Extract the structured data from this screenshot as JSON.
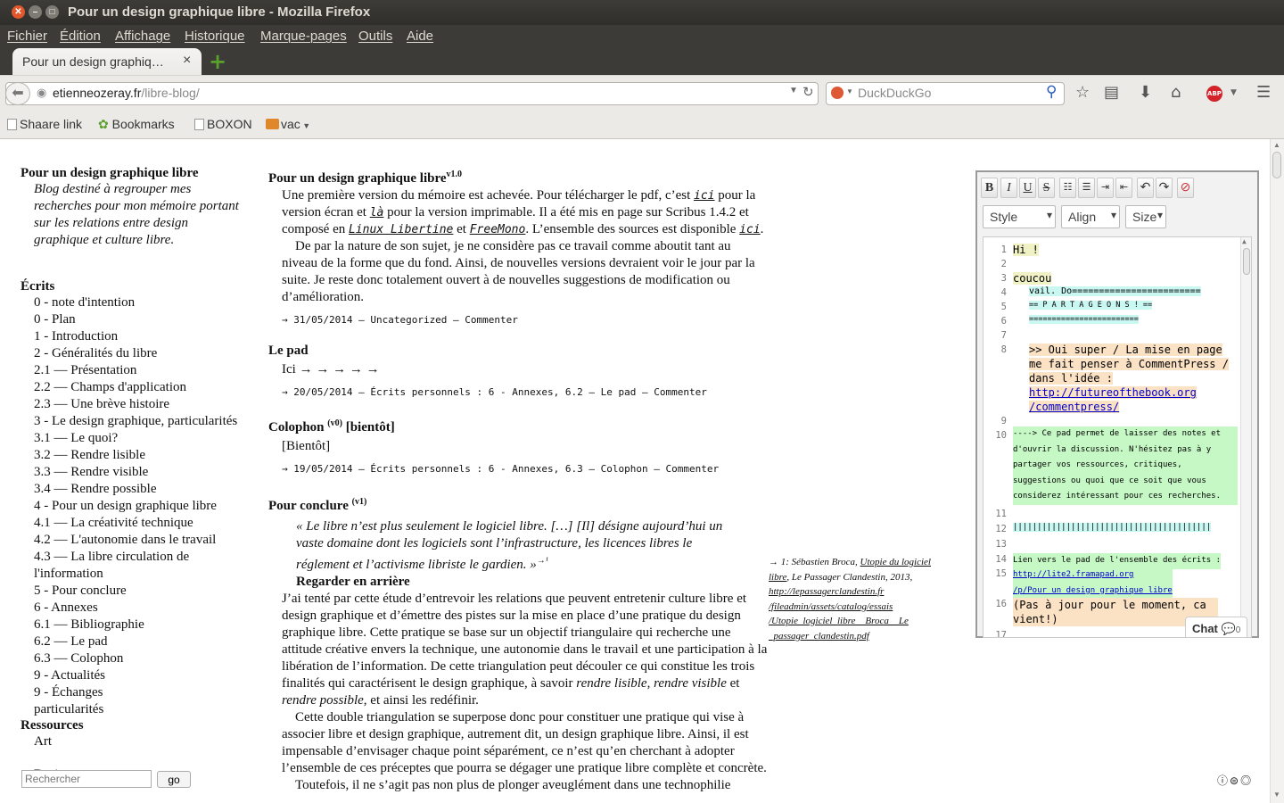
{
  "window": {
    "title": "Pour un design graphique libre - Mozilla Firefox"
  },
  "menu": [
    "Fichier",
    "Édition",
    "Affichage",
    "Historique",
    "Marque-pages",
    "Outils",
    "Aide"
  ],
  "tab": {
    "label": "Pour un design graphiq…",
    "close": "×",
    "new_tab": "+"
  },
  "urlbar": {
    "domain": "etienneozeray.fr",
    "path": "/libre-blog/"
  },
  "search": {
    "placeholder": "DuckDuckGo"
  },
  "bookmarks": [
    "Shaare link",
    "Bookmarks",
    "BOXON",
    "vac"
  ],
  "sidebar": {
    "site_title": "Pour un design graphique libre",
    "site_desc": "Blog destiné à regrouper mes recherches pour mon mémoire portant sur les relations entre design graphique et culture libre.",
    "ecrits_heading": "Écrits",
    "ecrits": [
      "0 - note d'intention",
      "0 - Plan",
      "1 - Introduction",
      "2 - Généralités du libre",
      "2.1 — Présentation",
      "2.2 — Champs d'application",
      "2.3 — Une brève histoire",
      "3 - Le design graphique, particularités",
      "3.1 — Le quoi?",
      "3.2 — Rendre lisible",
      "3.3 — Rendre visible",
      "3.4 — Rendre possible",
      "4 - Pour un design graphique libre",
      "4.1 — La créativité technique",
      "4.2 — L'autonomie dans le travail",
      "4.3 — La libre circulation de l'information",
      "5 - Pour conclure",
      "6 - Annexes",
      "6.1 — Bibliographie",
      "6.2 — Le pad",
      "6.3 — Colophon",
      "9 - Actualités",
      "9 - Échanges particularités"
    ],
    "ressources_heading": "Ressources",
    "ressources": [
      "Art",
      "Designers"
    ],
    "search_placeholder": "Rechercher",
    "search_button": "go"
  },
  "posts": {
    "p1": {
      "title": "Pour un design graphique libre",
      "version": "v1.0",
      "t1": "Une première version du mémoire est achevée. Pour télécharger le pdf, c’est ",
      "ici": "ici",
      "t2": " pour la version écran et ",
      "la": "là",
      "t3": " pour la version imprimable. Il a été mis en page sur Scribus 1.4.2 et composé en ",
      "font1": "Linux Libertine",
      "t4": " et ",
      "font2": "FreeMono",
      "t5": ". L’ensemble des sources est disponible ",
      "t6": ".",
      "para2": "De par la nature de son sujet, je ne considère pas ce travail comme aboutit tant au niveau de la forme que du fond. Ainsi, de nouvelles versions devraient voir le jour par la suite. Je reste donc totalement ouvert à de nouvelles suggestions de modification ou d’amélioration.",
      "meta": "→ 31/05/2014 — Uncategorized — Commenter"
    },
    "p2": {
      "title": "Le pad",
      "body": "Ici → → → → →",
      "meta": "→ 20/05/2014 — Écrits personnels : 6 - Annexes, 6.2 — Le pad — Commenter"
    },
    "p3": {
      "title": "Colophon",
      "version": "(v0)",
      "suffix": " [bientôt]",
      "body": "[Bientôt]",
      "meta": "→ 19/05/2014 — Écrits personnels : 6 - Annexes, 6.3 — Colophon — Commenter"
    },
    "p4": {
      "title": "Pour conclure",
      "version": "(v1)",
      "quote": "« Le libre n’est plus seulement le logiciel libre. […] [Il] désigne aujourd’hui un vaste domaine dont les logiciels sont l’infrastructure, les licences libres le réglement et l’activisme libriste le gardien. »",
      "quote_ref": "→¹",
      "subhead": "Regarder en arrière",
      "para1a": "J’ai tenté par cette étude d’entrevoir les relations que peuvent entretenir culture libre et design graphique et d’émettre des pistes sur la mise en place d’une pratique du design graphique libre. Cette pratique se base sur un objectif triangulaire qui recherche une attitude créative envers la technique, une autonomie dans le travail et une participation à la libération de l’information. De cette triangulation peut découler ce qui constitue les trois finalités qui caractérisent le design graphique, à savoir ",
      "em1": "rendre lisible",
      "sep": ", ",
      "em2": "rendre visible",
      "and": " et ",
      "em3": "rendre possible",
      "para1b": ", et ainsi les redéfinir.",
      "para2": "Cette double triangulation se superpose donc pour constituer une pratique qui vise à associer libre et design graphique, autrement dit, un design graphique libre. Ainsi, il est impensable d’envisager chaque point séparément, ce n’est qu’en cherchant à adopter l’ensemble de ces préceptes que pourra se dégager une pratique libre complète et concrète.",
      "para3": "Toutefois, il ne s’agit pas non plus de plonger aveuglément dans une technophilie"
    }
  },
  "note": {
    "prefix": "→ 1: Sébastien Broca, ",
    "book": "Utopie du logiciel libre",
    "publisher": ", Le Passager Clandestin, 2013,",
    "url": "http://lepassagerclandestin.fr/fileadmin/assets/catalog/essais/Utopie_logiciel_libre__Broca__Le_passager_clandestin.pdf",
    "url_lines": [
      "http://lepassagerclandestin.fr",
      "/fileadmin/assets/catalog/essais",
      "/Utopie_logiciel_libre__Broca__Le",
      "_passager_clandestin.pdf"
    ]
  },
  "editor": {
    "toolbar": [
      "B",
      "I",
      "U",
      "S",
      "ol",
      "ul",
      "indent",
      "outdent",
      "undo",
      "redo",
      "clear"
    ],
    "style": "Style",
    "align": "Align",
    "size": "Size",
    "lines": {
      "l1": "Hi !",
      "l3": "coucou",
      "l4": "vail. Do========================",
      "l5": "== P A R T A G E O N S ! ==",
      "l6": "========================",
      "l8a": ">> Oui super / La mise en page me fait penser à CommentPress / dans l'idée : ",
      "l8link": "http://futureofthebook.org/commentpress/",
      "l8link_lines": [
        "http://futureofthebook.org",
        "/commentpress/"
      ],
      "l10": "----> Ce pad permet de laisser des notes et d'ouvrir la discussion. N'hésitez pas à y partager vos ressources, critiques, suggestions ou quoi que ce soit que vous considerez intéressant pour ces recherches.",
      "l12": "|||||||||||||||||||||||||||||||||||||||||",
      "l14": "Lien vers le pad de l'ensemble des écrits :",
      "l15a": "http://lite2.framapad.org",
      "l15b": "/p/Pour_un_design_graphique_libre",
      "l16": "(Pas à jour pour le moment, ca vient!)"
    },
    "numbers": [
      "1",
      "2",
      "3",
      "4",
      "5",
      "6",
      "7",
      "8",
      "9",
      "10",
      "11",
      "12",
      "13",
      "14",
      "15",
      "16",
      "17"
    ],
    "chat_label": "Chat",
    "chat_count": "0"
  },
  "colors": {
    "chrome_dark": "#3c3b37",
    "chrome_light": "#ebeae7",
    "pad_yellow": "#f0f2c6",
    "pad_cyan": "#c9f7f2",
    "pad_orange": "#fbe2c4",
    "pad_green": "#c5f8c5",
    "link_blue": "#0000cc"
  }
}
